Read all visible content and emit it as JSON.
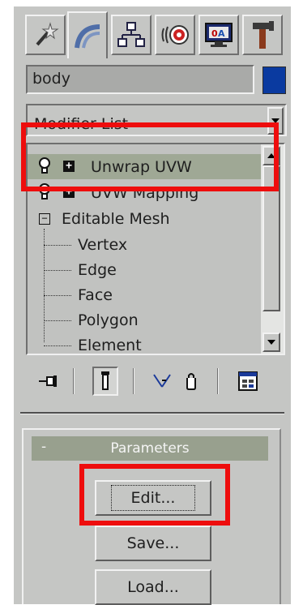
{
  "command_panel": {
    "tabs": [
      {
        "name": "create",
        "icon": "wand-star-icon"
      },
      {
        "name": "modify",
        "icon": "modify-bend-icon",
        "active": true
      },
      {
        "name": "hierarchy",
        "icon": "hierarchy-icon"
      },
      {
        "name": "motion",
        "icon": "motion-icon"
      },
      {
        "name": "display",
        "icon": "display-monitor-icon"
      },
      {
        "name": "utilities",
        "icon": "hammer-icon"
      }
    ],
    "object_name": "body",
    "object_color": "#0a3aa0",
    "modifier_list": {
      "selected": "Modifier List"
    }
  },
  "stack": {
    "items": [
      {
        "label": "Unwrap UVW",
        "selected": true
      },
      {
        "label": "UVW Mapping",
        "selected": false
      },
      {
        "label": "Editable Mesh",
        "selected": false
      }
    ],
    "sub_objects": [
      "Vertex",
      "Edge",
      "Face",
      "Polygon",
      "Element"
    ]
  },
  "stack_toolbar": [
    "pin-stack-icon",
    "show-end-result-icon",
    "make-unique-icon",
    "remove-modifier-icon",
    "configure-modifier-sets-icon"
  ],
  "parameters": {
    "title": "Parameters",
    "collapse_symbol": "-",
    "buttons": {
      "edit": "Edit...",
      "save": "Save...",
      "load": "Load..."
    }
  },
  "highlight_color": "#ee0d0d"
}
